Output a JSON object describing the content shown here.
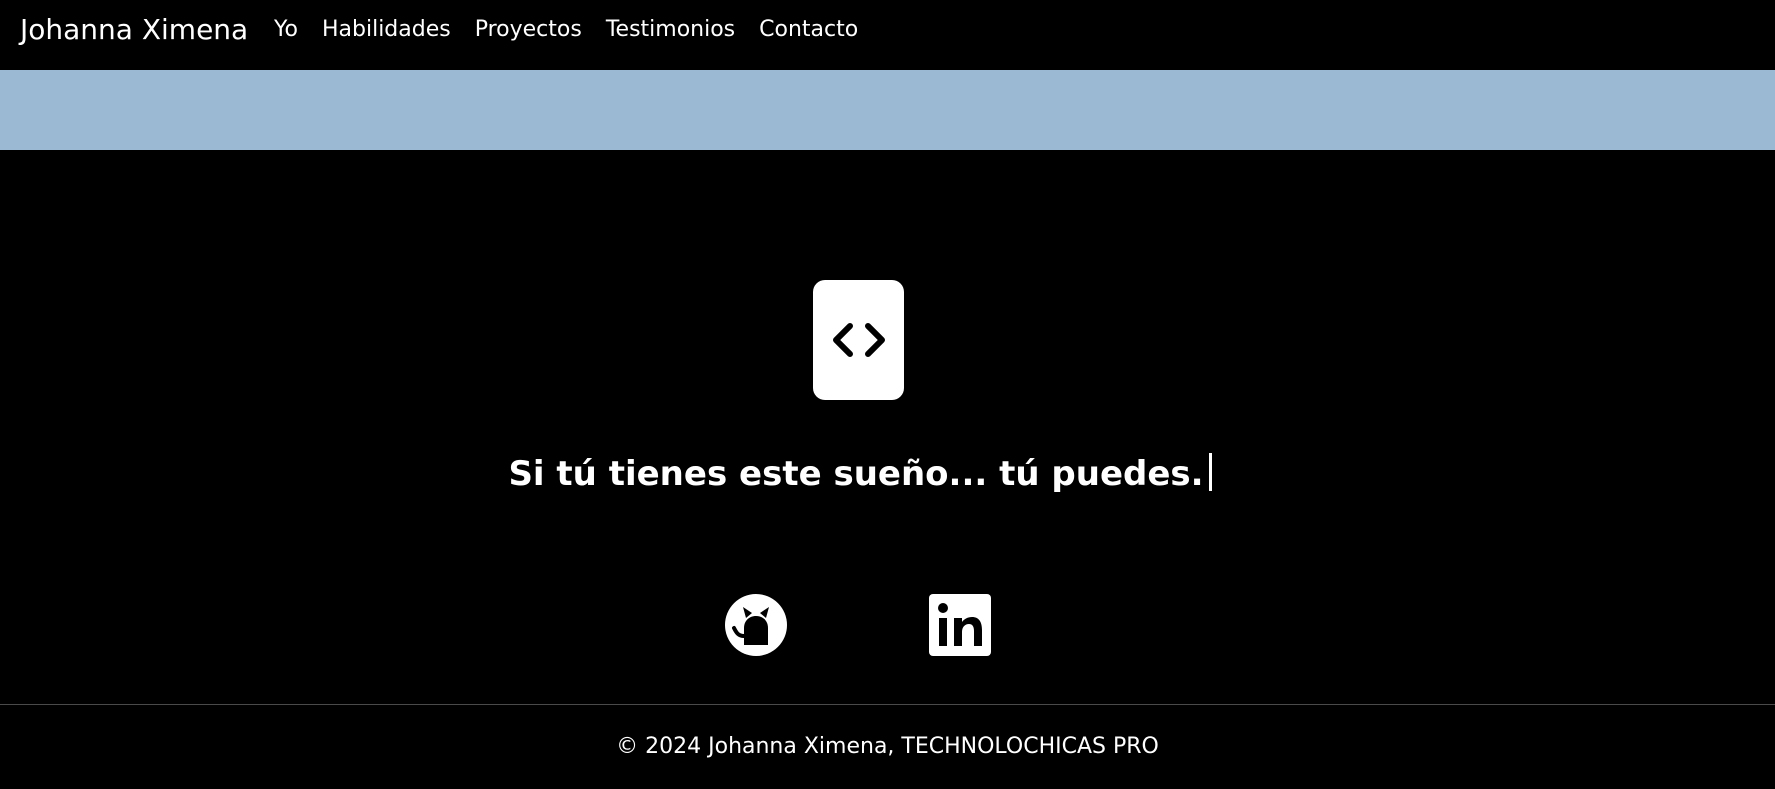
{
  "navbar": {
    "brand": "Johanna Ximena",
    "links": [
      "Yo",
      "Habilidades",
      "Proyectos",
      "Testimonios",
      "Contacto"
    ]
  },
  "hero": {
    "icon": "code-brackets-icon",
    "tagline": "Si tú tienes este sueño... tú puedes."
  },
  "social": {
    "github_icon": "github-icon",
    "linkedin_icon": "linkedin-icon"
  },
  "footer": {
    "text": "© 2024 Johanna Ximena, TECHNOLOCHICAS PRO"
  },
  "colors": {
    "background": "#000000",
    "band": "#9BB9D2",
    "text": "#FFFFFF"
  }
}
